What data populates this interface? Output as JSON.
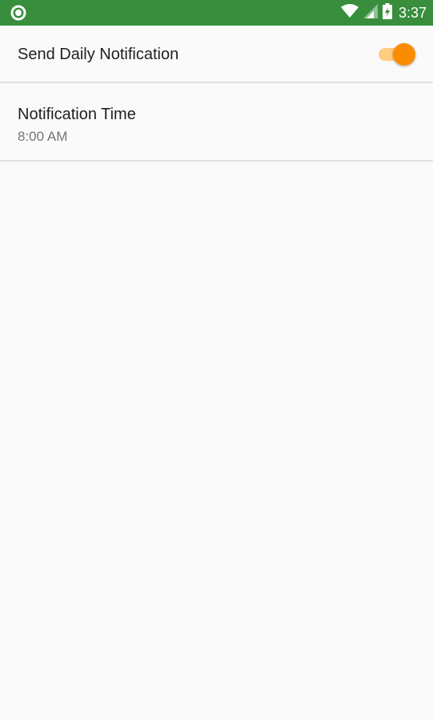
{
  "status_bar": {
    "time": "3:37",
    "left_icon": "notification-circle-icon",
    "right_icons": [
      "wifi-icon",
      "cell-signal-icon",
      "battery-charging-icon"
    ],
    "background": "#388e3c"
  },
  "settings": {
    "send_daily": {
      "title": "Send Daily Notification",
      "enabled": true,
      "accent": "#fb8c00"
    },
    "notification_time": {
      "title": "Notification Time",
      "summary": "8:00 AM"
    }
  }
}
